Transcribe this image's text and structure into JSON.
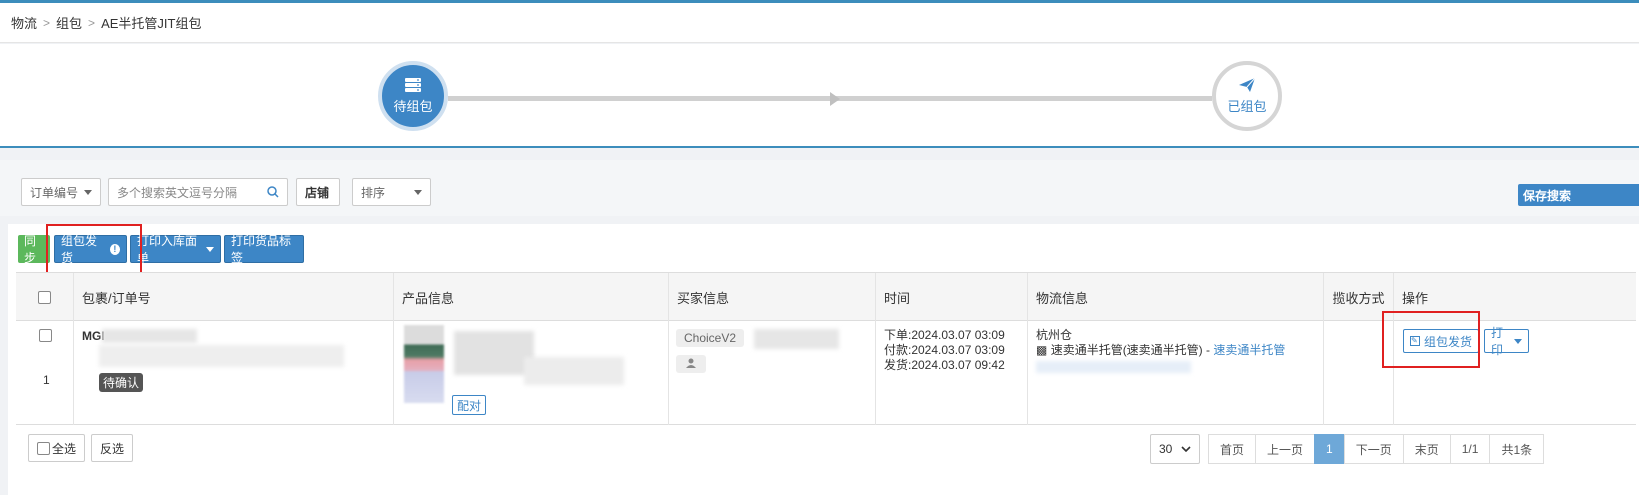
{
  "breadcrumb": [
    "物流",
    "组包",
    "AE半托管JIT组包"
  ],
  "steps": {
    "active_label": "待组包",
    "done_label": "已组包"
  },
  "filters": {
    "order_select": "订单编号",
    "search_placeholder": "多个搜索英文逗号分隔",
    "shop_button": "店铺",
    "sort_select": "排序",
    "save_search": "保存搜索"
  },
  "toolbar": {
    "sync": "同步",
    "pack_ship": "组包发货",
    "print_inbound": "打印入库面单",
    "print_label": "打印货品标签"
  },
  "table": {
    "headers": [
      "包裹/订单号",
      "产品信息",
      "买家信息",
      "时间",
      "物流信息",
      "揽收方式",
      "操作"
    ],
    "row": {
      "order_prefix": "MGI",
      "index": "1",
      "status": "待确认",
      "match": "配对",
      "buyer_tag": "ChoiceV2",
      "time_order": "下单:2024.03.07 03:09",
      "time_pay": "付款:2024.03.07 03:09",
      "time_ship": "发货:2024.03.07 09:42",
      "warehouse": "杭州仓",
      "logistics_text": "速卖通半托管(速卖通半托管) - ",
      "logistics_link": "速卖通半托管",
      "action_pack": "组包发货",
      "action_print": "打印"
    }
  },
  "footer": {
    "select_all": "全选",
    "invert": "反选",
    "page_size": "30",
    "first": "首页",
    "prev": "上一页",
    "current": "1",
    "next": "下一页",
    "last": "末页",
    "page_info": "1/1",
    "total": "共1条"
  }
}
